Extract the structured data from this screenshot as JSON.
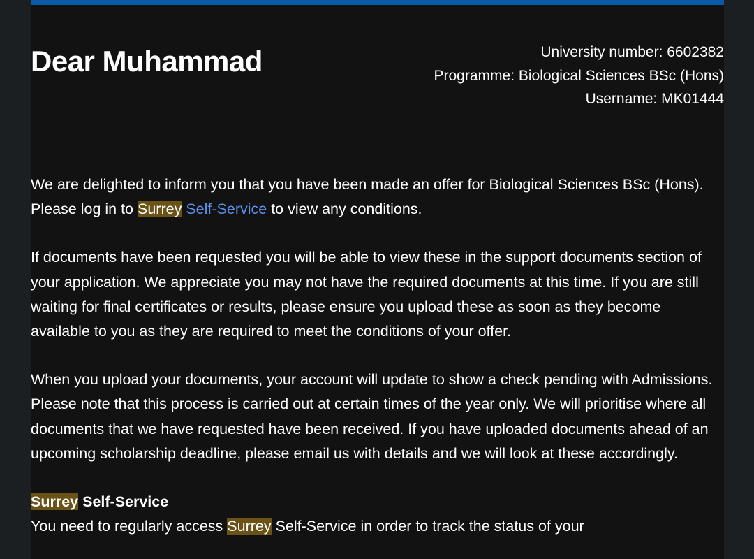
{
  "colors": {
    "background": "#1c1f22",
    "card": "#121212",
    "accent_bar": "#0b5aa8",
    "link": "#5b8fe8",
    "highlight": "#6b5317"
  },
  "greeting": "Dear Muhammad",
  "meta": {
    "university_number": "University number: 6602382",
    "programme": "Programme: Biological Sciences BSc (Hons)",
    "username": "Username: MK01444"
  },
  "para1": {
    "text_before": "We are delighted to inform you that you have been made an offer for Biological Sciences BSc (Hons). Please log in to ",
    "highlight": "Surrey",
    "link": "Self-Service",
    "text_after": " to view any conditions."
  },
  "para2": "If documents have been requested you will be able to view these in the support documents section of your application. We appreciate you may not have the required documents at this time. If you are still waiting for final certificates or results, please ensure you upload these as soon as they become available to you as they are required to meet the conditions of your offer.",
  "para3": "When you upload your documents, your account will update to show a check pending with Admissions. Please note that this process is carried out at certain times of the year only. We will prioritise where all documents that we have requested have been received. If you have uploaded documents ahead of an upcoming scholarship deadline, please email us with details and we will look at these accordingly.",
  "section": {
    "title_highlight": "Surrey",
    "title_rest": " Self-Service",
    "text_before": "You need to regularly access ",
    "highlight": "Surrey",
    "text_after": " Self-Service in order to track the status of your"
  }
}
